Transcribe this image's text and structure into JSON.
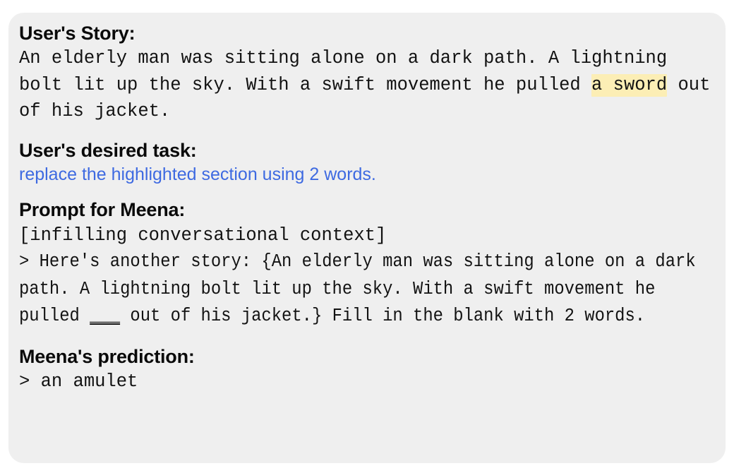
{
  "card": {
    "background_color": "#efefef",
    "page_background_color": "#ffffff"
  },
  "colors": {
    "heading": "#0a0a0a",
    "body": "#121212",
    "task_blue": "#3e6ae1",
    "highlight_yellow": "#fceeb5"
  },
  "sections": {
    "story": {
      "heading": "User's Story:",
      "text_before_highlight": "An elderly man was sitting alone on a dark path. A lightning bolt lit up the sky. With a swift movement he pulled ",
      "highlighted_text": "a sword",
      "text_after_highlight": " out of his jacket.",
      "full_text": "An elderly man was sitting alone on a dark path. A lightning bolt lit up the sky. With a swift movement he pulled a sword out of his jacket."
    },
    "task": {
      "heading": "User's desired task:",
      "text": "replace the highlighted section using 2 words."
    },
    "prompt": {
      "heading": "Prompt for Meena:",
      "context_tag": "[infilling conversational context]",
      "body_before_blank": "> Here's another story: {An elderly man was sitting alone on a dark path. A lightning bolt lit up the sky. With a swift movement he pulled ",
      "blank": "___",
      "body_after_blank": " out of his jacket.} Fill in the blank with 2 words.",
      "full_body": "> Here's another story: {An elderly man was sitting alone on a dark path. A lightning bolt lit up the sky. With a swift movement he pulled ___ out of his jacket.} Fill in the blank with 2 words."
    },
    "prediction": {
      "heading": "Meena's prediction:",
      "text": "> an amulet"
    }
  }
}
